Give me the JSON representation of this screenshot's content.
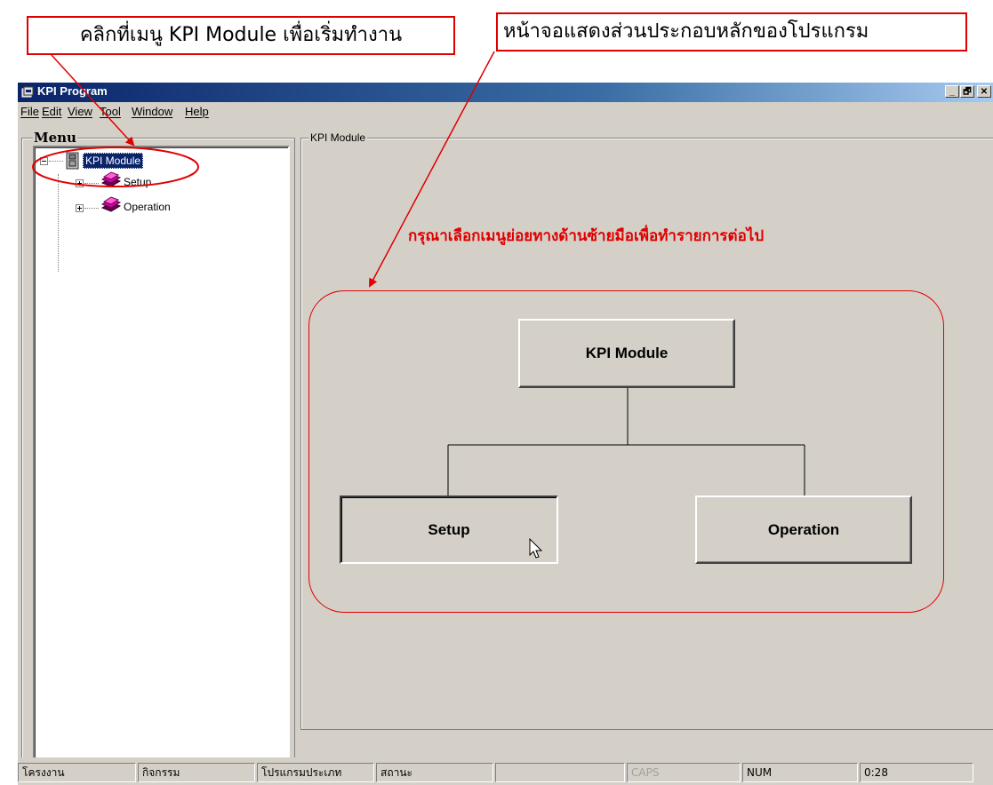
{
  "annotations": {
    "left_callout": "คลิกที่เมนู KPI Module เพื่อเริ่มทำงาน",
    "right_callout": "หน้าจอแสดงส่วนประกอบหลักของโปรแกรม"
  },
  "window": {
    "title": "KPI Program",
    "controls": {
      "minimize": "_",
      "restore": "🗗",
      "close": "✕"
    }
  },
  "menubar": {
    "items": [
      "File",
      "Edit",
      "View",
      "Tool",
      "Window",
      "Help"
    ]
  },
  "menu_panel": {
    "legend": "Menu",
    "tree": {
      "root": {
        "label": "KPI Module",
        "icon": "cabinet-icon",
        "expanded": true,
        "selected": true
      },
      "children": [
        {
          "label": "Setup",
          "icon": "books-icon",
          "expanded": false
        },
        {
          "label": "Operation",
          "icon": "books-icon",
          "expanded": false
        }
      ]
    }
  },
  "kpi_panel": {
    "legend": "KPI Module",
    "hint": "กรุณาเลือกเมนูย่อยทางด้านซ้ายมือเพื่อทำรายการต่อไป",
    "diagram": {
      "root": "KPI Module",
      "children": [
        "Setup",
        "Operation"
      ]
    }
  },
  "statusbar": {
    "panels": [
      "โครงงาน",
      "กิจกรรม",
      "โปรแกรมประเภท",
      "สถานะ",
      "",
      "CAPS",
      "NUM",
      "0:28"
    ]
  },
  "colors": {
    "annotation_red": "#e00000",
    "title_blue": "#0a246a",
    "face": "#d4d0c8"
  }
}
